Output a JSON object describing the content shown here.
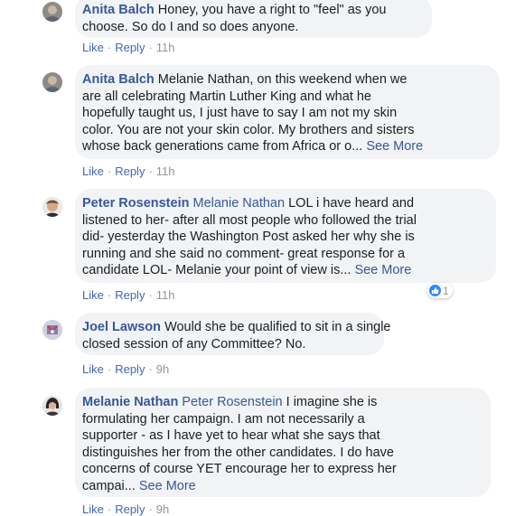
{
  "comments": [
    {
      "author": "Anita Balch",
      "tag": "",
      "lines": [
        "Honey, you have a right to \"feel\" as you",
        "choose. So do I and so does anyone."
      ],
      "see_more": "",
      "actions": {
        "like": "Like",
        "reply": "Reply",
        "time": "11h"
      }
    },
    {
      "author": "Anita Balch",
      "tag": "",
      "lines": [
        "Melanie Nathan, on this weekend when we",
        "are all celebrating Martin Luther King and what he",
        "hopefully taught us, I just have to say I am not my skin",
        "color. You are not your skin color. My brothers and sisters",
        "whose back generations came from Africa or o..."
      ],
      "see_more": "See More",
      "actions": {
        "like": "Like",
        "reply": "Reply",
        "time": "11h"
      }
    },
    {
      "author": "Peter Rosenstein",
      "tag": "Melanie Nathan",
      "lines": [
        "LOL i have heard and",
        "listened to her- after all most people who followed the trial",
        "did- yesterday the Washington Post asked her why she is",
        "running and she said no comment- great response for a",
        "candidate LOL- Melanie your point of view is..."
      ],
      "see_more": "See More",
      "reaction_count": "1",
      "actions": {
        "like": "Like",
        "reply": "Reply",
        "time": "11h"
      }
    },
    {
      "author": "Joel Lawson",
      "tag": "",
      "lines": [
        "Would she be qualified to sit in a single",
        "closed session of any Committee? No."
      ],
      "see_more": "",
      "actions": {
        "like": "Like",
        "reply": "Reply",
        "time": "9h"
      }
    },
    {
      "author": "Melanie Nathan",
      "tag": "Peter Rosenstein",
      "lines": [
        "I imagine she is",
        "formulating her campaign. I am not necessarily a",
        "supporter - as I have yet to hear what she says that",
        "distinguishes her from the other candidates. I do have",
        "concerns of course YET encourage her to express her",
        "campai..."
      ],
      "see_more": "See More",
      "actions": {
        "like": "Like",
        "reply": "Reply",
        "time": "9h"
      }
    }
  ]
}
